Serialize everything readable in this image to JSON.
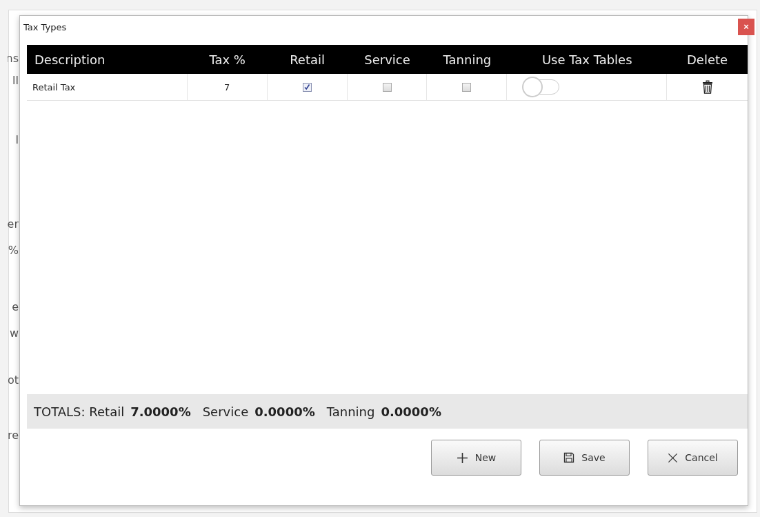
{
  "background_fragments": [
    "ns",
    "ll",
    "l",
    "er",
    "%",
    "e",
    "w",
    "ot",
    "re"
  ],
  "dialog": {
    "title": "Tax Types",
    "close": "×"
  },
  "table": {
    "columns": [
      "Description",
      "Tax %",
      "Retail",
      "Service",
      "Tanning",
      "Use Tax Tables",
      "Delete"
    ],
    "rows": [
      {
        "description": "Retail Tax",
        "tax": "7",
        "retail": true,
        "service": false,
        "tanning": false,
        "use_tax_tables": false
      }
    ]
  },
  "totals": [
    {
      "label": "TOTALS: Retail",
      "value": "7.0000%"
    },
    {
      "label": "Service",
      "value": "0.0000%"
    },
    {
      "label": "Tanning",
      "value": "0.0000%"
    }
  ],
  "buttons": [
    {
      "kind": "new",
      "label": "New"
    },
    {
      "kind": "save",
      "label": "Save"
    },
    {
      "kind": "cancel",
      "label": "Cancel"
    }
  ]
}
